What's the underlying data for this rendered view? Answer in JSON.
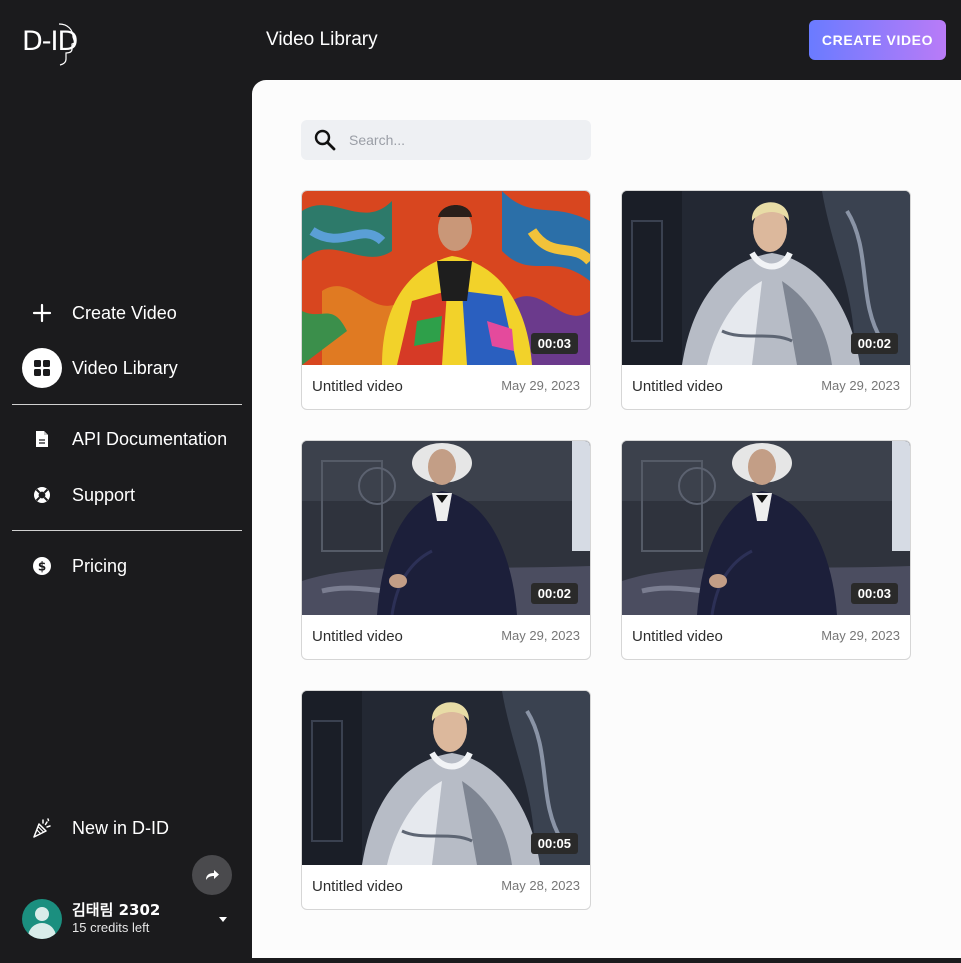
{
  "brand": {
    "logo_text": "D-ID"
  },
  "header": {
    "title": "Video Library",
    "create_button": "CREATE VIDEO"
  },
  "sidebar": {
    "items": [
      {
        "label": "Create Video",
        "icon": "plus-icon"
      },
      {
        "label": "Video Library",
        "icon": "grid-icon",
        "active": true
      },
      {
        "label": "API Documentation",
        "icon": "document-icon"
      },
      {
        "label": "Support",
        "icon": "lifebuoy-icon"
      },
      {
        "label": "Pricing",
        "icon": "dollar-icon"
      },
      {
        "label": "New in D-ID",
        "icon": "party-popper-icon"
      }
    ]
  },
  "user": {
    "name": "김태림 2302",
    "credits": "15 credits left"
  },
  "search": {
    "placeholder": "Search..."
  },
  "videos": [
    {
      "title": "Untitled video",
      "date": "May 29, 2023",
      "duration": "00:03",
      "thumbnail": "man-colorful-jacket"
    },
    {
      "title": "Untitled video",
      "date": "May 29, 2023",
      "duration": "00:02",
      "thumbnail": "blond-man-silver-cape"
    },
    {
      "title": "Untitled video",
      "date": "May 29, 2023",
      "duration": "00:02",
      "thumbnail": "white-haired-man-suit"
    },
    {
      "title": "Untitled video",
      "date": "May 29, 2023",
      "duration": "00:03",
      "thumbnail": "white-haired-man-suit"
    },
    {
      "title": "Untitled video",
      "date": "May 28, 2023",
      "duration": "00:05",
      "thumbnail": "blond-man-silver-cape"
    }
  ],
  "colors": {
    "sidebar_bg": "#1b1b1d",
    "main_bg": "#fcfcfc",
    "accent_start": "#6a7bff",
    "accent_end": "#b97bf7",
    "avatar": "#1b8f7f"
  }
}
